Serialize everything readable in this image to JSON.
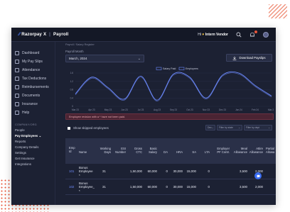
{
  "app": {
    "brand": "Razorpay",
    "brand_suffix": "X",
    "product": "Payroll"
  },
  "header": {
    "greeting": "Hi",
    "user_name": "Intern Vendor"
  },
  "sidebar": {
    "items": [
      {
        "label": "Dashboard"
      },
      {
        "label": "My Pay Slips"
      },
      {
        "label": "Attendance"
      },
      {
        "label": "Tax Deductions"
      },
      {
        "label": "Reimbursements"
      },
      {
        "label": "Documents"
      },
      {
        "label": "Insurance"
      },
      {
        "label": "Help"
      }
    ],
    "section_title": "COMPANY/ORG",
    "links": [
      {
        "label": "People"
      },
      {
        "label": "Pay Employees",
        "suffix": "⌄"
      },
      {
        "label": "Reports"
      },
      {
        "label": "Company Details"
      },
      {
        "label": "Settings"
      },
      {
        "label": "Get Insurance"
      },
      {
        "label": "Integrations"
      }
    ]
  },
  "main": {
    "breadcrumb": "Payroll / Salary Register",
    "payroll_month_label": "Payroll Month",
    "payroll_month_value": "March, 2024",
    "download_label": "Download Payslips",
    "alert": "Employee revision with a * have not been paid.",
    "show_skipped_label": "Show skipped employees",
    "filters": [
      "Dec",
      "Filter by state",
      "Filter by dept"
    ]
  },
  "chart_data": {
    "type": "line",
    "legend": [
      "Salary Paid",
      "Employees"
    ],
    "yticks": [
      "1.6",
      "1.2",
      "0.8",
      "0.4",
      "0"
    ],
    "categories": [
      "Mar 23",
      "Apr 23",
      "May 23",
      "Jun 23",
      "Jul 23",
      "Aug 23",
      "Sep 23",
      "Oct 23",
      "Nov 23",
      "Dec 23",
      "Jan 24",
      "Feb 24",
      "Mar 24"
    ],
    "series": [
      {
        "name": "Salary Paid",
        "values": [
          0.6,
          1.4,
          0.9,
          0.35,
          1.45,
          0.3,
          1.55,
          1.4,
          0.4,
          1.5,
          1.6,
          1.0,
          0.5
        ]
      },
      {
        "name": "Employees",
        "values": [
          0.55,
          1.35,
          0.85,
          0.3,
          1.4,
          0.25,
          1.5,
          1.35,
          0.35,
          1.45,
          1.55,
          0.95,
          0.45
        ]
      }
    ],
    "ylim": [
      0,
      1.6
    ],
    "colors": {
      "line": "#6d8bff",
      "grid": "#2b3149",
      "tick": "#8a90a8"
    }
  },
  "table": {
    "columns": [
      "Emp Id",
      "Name",
      "Working Days",
      "ESI Number",
      "Gross CTC",
      "Basic Salary",
      "DA",
      "HRA",
      "SA",
      "LTA",
      "Employer PF Contr.",
      "Meal Allowance",
      "Attire Allowance",
      "Partial Allowa"
    ],
    "rows": [
      [
        "101",
        "Bonus Employee *",
        "31",
        "",
        "1,50,000",
        "60,000",
        "0",
        "30,000",
        "15,000",
        "0",
        "",
        "3,500",
        "2,000",
        ""
      ],
      [
        "102",
        "Bonus Employee_ *",
        "31",
        "",
        "1,50,000",
        "60,000",
        "0",
        "30,000",
        "15,000",
        "0",
        "",
        "3,500",
        "2,000",
        ""
      ]
    ]
  }
}
